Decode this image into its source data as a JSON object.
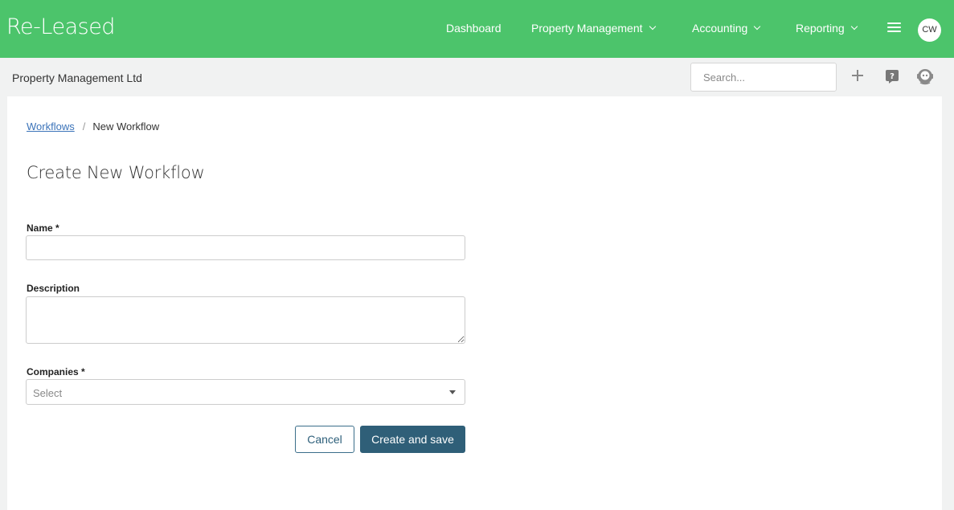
{
  "header": {
    "logo": "Re-Leased",
    "nav": [
      {
        "label": "Dashboard",
        "has_dropdown": false
      },
      {
        "label": "Property Management",
        "has_dropdown": true
      },
      {
        "label": "Accounting",
        "has_dropdown": true
      },
      {
        "label": "Reporting",
        "has_dropdown": true
      }
    ],
    "menu_icon": "hamburger-icon",
    "avatar_initials": "CW",
    "brand_color": "#4cc46b"
  },
  "subheader": {
    "company": "Property Management Ltd",
    "search_placeholder": "Search...",
    "icons": [
      "plus-icon",
      "help-icon",
      "assistant-bot-icon"
    ]
  },
  "breadcrumb": {
    "parent": "Workflows",
    "separator": "/",
    "current": "New Workflow"
  },
  "page": {
    "title": "Create New Workflow"
  },
  "form": {
    "name_label": "Name *",
    "name_value": "",
    "description_label": "Description",
    "description_value": "",
    "companies_label": "Companies *",
    "companies_placeholder": "Select",
    "cancel_label": "Cancel",
    "save_label": "Create and save",
    "primary_color": "#2f5f78"
  }
}
